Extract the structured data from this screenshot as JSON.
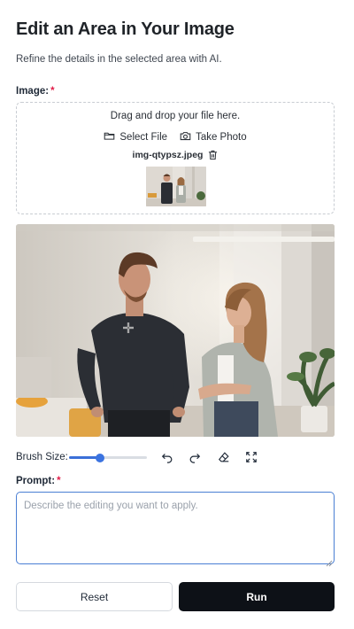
{
  "header": {
    "title": "Edit an Area in Your Image",
    "subtitle": "Refine the details in the selected area with AI."
  },
  "image_field": {
    "label": "Image:",
    "required_mark": "*",
    "drop_text": "Drag and drop your file here.",
    "select_file_label": "Select File",
    "take_photo_label": "Take Photo",
    "file_name": "img-qtypsz.jpeg",
    "icons": {
      "select_file": "folder-icon",
      "take_photo": "camera-icon",
      "remove": "trash-icon"
    }
  },
  "editor": {
    "brush_label": "Brush Size:",
    "brush_level": 0.4,
    "tools": [
      "undo-icon",
      "redo-icon",
      "eraser-icon",
      "fullscreen-icon"
    ],
    "cursor": "crosshair-move-icon"
  },
  "prompt_field": {
    "label": "Prompt:",
    "required_mark": "*",
    "placeholder": "Describe the editing you want to apply.",
    "value": ""
  },
  "actions": {
    "reset_label": "Reset",
    "run_label": "Run"
  },
  "colors": {
    "accent": "#3b73e0",
    "required": "#e11d48",
    "run_button": "#0d1117",
    "focus_border": "#4a7fd4"
  }
}
